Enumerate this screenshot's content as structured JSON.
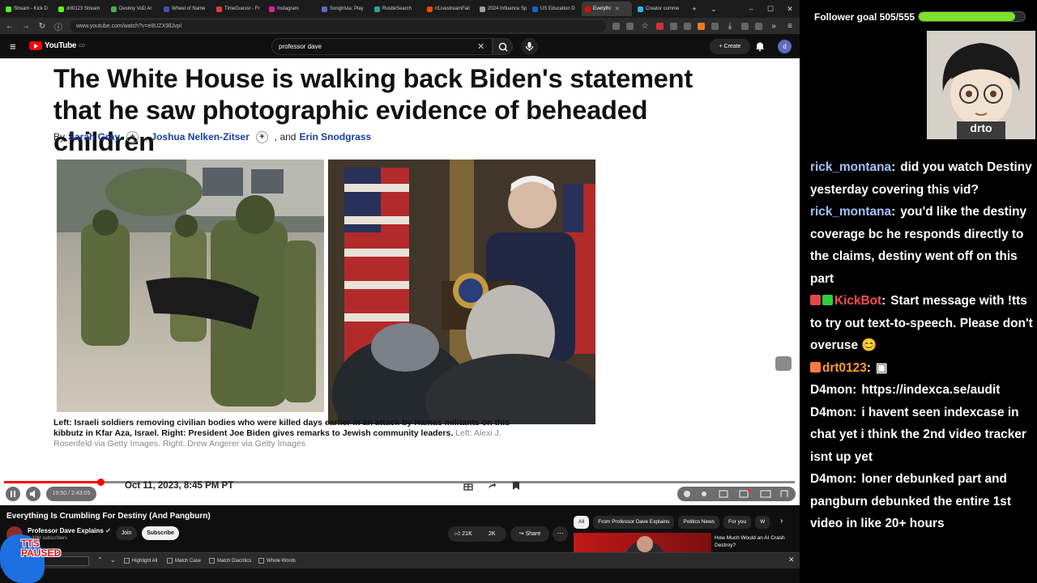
{
  "browser": {
    "tabs": [
      {
        "label": "Stream - Kick D",
        "color": "#53fc18"
      },
      {
        "label": "drt0123 Stream",
        "color": "#53fc18"
      },
      {
        "label": "Destiny VoD Ar",
        "color": "#4caf50"
      },
      {
        "label": "Wheel of Name",
        "color": "#3f51b5"
      },
      {
        "label": "TimeGuessr - Fr",
        "color": "#e53935"
      },
      {
        "label": "Instagram",
        "color": "#d6249f"
      },
      {
        "label": "Songtrivia: Play",
        "color": "#5c6bc0"
      },
      {
        "label": "RustleSearch",
        "color": "#26a69a"
      },
      {
        "label": "r/LivestreamFail",
        "color": "#ff4500"
      },
      {
        "label": "2024 Influence Spe",
        "color": "#9e9e9e"
      },
      {
        "label": "US Education D",
        "color": "#1565c0"
      },
      {
        "label": "Everythi",
        "color": "#ff0000",
        "active": true
      },
      {
        "label": "Creator comme",
        "color": "#29b6f6"
      }
    ],
    "new_tab": "+",
    "url": "www.youtube.com/watch?v=e8UZX9llJvpI"
  },
  "youtube": {
    "logo_text": "YouTube",
    "logo_sup": "CO",
    "search_query": "professor dave",
    "create_label": "Create",
    "avatar_letter": "d"
  },
  "article": {
    "headline": "The White House is walking back Biden's statement that he saw photographic evidence of beheaded children",
    "by": "By",
    "authors": [
      "Sarah Gray",
      "Joshua Nelken-Zitser",
      "Erin Snodgrass"
    ],
    "sep1": ",",
    "sep2": ", and",
    "caption": "Left: Israeli soldiers removing civilian bodies who were killed days earlier in an attack by Hamas militants on this kibbutz in Kfar Aza, Israel. Right: President Joe Biden gives remarks to Jewish community leaders.",
    "credit": "Left: Alexi J. Rosenfeld via Getty Images. Right: Drew Angerer via Getty Images",
    "date": "Oct 11, 2023, 8:45 PM PT"
  },
  "player": {
    "progress": 0.122,
    "time": "19:50 / 2:43:05"
  },
  "video": {
    "title": "Everything Is Crumbling For Destiny (And Pangburn)",
    "channel": "Professor Dave Explains",
    "subs": "4.39M subscribers",
    "join": "Join",
    "subscribe": "Subscribe",
    "likes": "21K",
    "dislikes": "2K",
    "share": "Share",
    "chips": [
      "All",
      "From Professor Dave Explains",
      "Politics News",
      "For you",
      "W"
    ],
    "rec_title": "How Much Would an AI Crash Destroy?"
  },
  "findbar": {
    "options": [
      "Highlight All",
      "Match Case",
      "Match Diacritics",
      "Whole Words"
    ]
  },
  "overlay": {
    "tts_line1": "TTS",
    "tts_line2": "PAUSED"
  },
  "chat": {
    "goal_label": "Follower goal 505/555",
    "goal_fraction": 0.91,
    "cam_label": "drto",
    "messages": [
      {
        "user": "rick_montana",
        "user_color": "#9fc3ff",
        "text": "did you watch Destiny yesterday covering this vid?"
      },
      {
        "user": "rick_montana",
        "user_color": "#9fc3ff",
        "text": "you'd like the destiny coverage bc he responds directly to the claims, destiny went off on this part"
      },
      {
        "user": "KickBot",
        "user_color": "#ff4d4d",
        "badges": [
          "#e04848",
          "#2ecc40"
        ],
        "text": "Start message with !tts to try out text-to-speech. Please don't overuse 😊"
      },
      {
        "user": "drt0123",
        "user_color": "#ff9a2e",
        "badges": [
          "#ff7a3d"
        ],
        "text": "▣"
      },
      {
        "user": "D4mon",
        "user_color": "#ffffff",
        "text": "https://indexca.se/audit"
      },
      {
        "user": "D4mon",
        "user_color": "#ffffff",
        "text": "i havent seen indexcase in chat yet i think the 2nd video tracker isnt up yet"
      },
      {
        "user": "D4mon",
        "user_color": "#ffffff",
        "text": "loner debunked part and pangburn debunked the entire 1st video in like 20+ hours"
      }
    ]
  }
}
